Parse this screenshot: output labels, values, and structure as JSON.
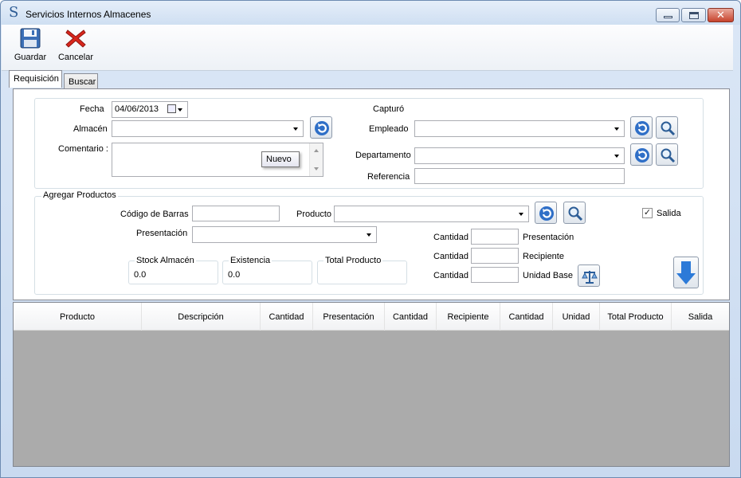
{
  "window": {
    "title": "Servicios Internos Almacenes",
    "close_glyph": "✕"
  },
  "toolbar": {
    "save_label": "Guardar",
    "cancel_label": "Cancelar"
  },
  "tabs": [
    {
      "label": "Requisición"
    },
    {
      "label": "Buscar"
    }
  ],
  "form": {
    "fecha_label": "Fecha",
    "fecha_value": "04/06/2013",
    "almacen_label": "Almacén",
    "almacen_value": "",
    "comentario_label": "Comentario :",
    "capturo_label": "Capturó",
    "empleado_label": "Empleado",
    "departamento_label": "Departamento",
    "referencia_label": "Referencia",
    "tooltip": "Nuevo"
  },
  "productos": {
    "group_label": "Agregar Productos",
    "codigo_label": "Código de Barras",
    "producto_label": "Producto",
    "presentacion_label": "Presentación",
    "salida_label": "Salida",
    "salida_checked": "✓",
    "stock_label": "Stock Almacén",
    "stock_value": "0.0",
    "existencia_label": "Existencia",
    "existencia_value": "0.0",
    "total_label": "Total Producto",
    "cantidad_label": "Cantidad",
    "cant_presentacion_label": "Presentación",
    "cant_recipiente_label": "Recipiente",
    "cant_unidad_label": "Unidad Base"
  },
  "grid": {
    "columns": [
      "Producto",
      "Descripción",
      "Cantidad",
      "Presentación",
      "Cantidad",
      "Recipiente",
      "Cantidad",
      "Unidad",
      "Total Producto",
      "Salida"
    ]
  }
}
